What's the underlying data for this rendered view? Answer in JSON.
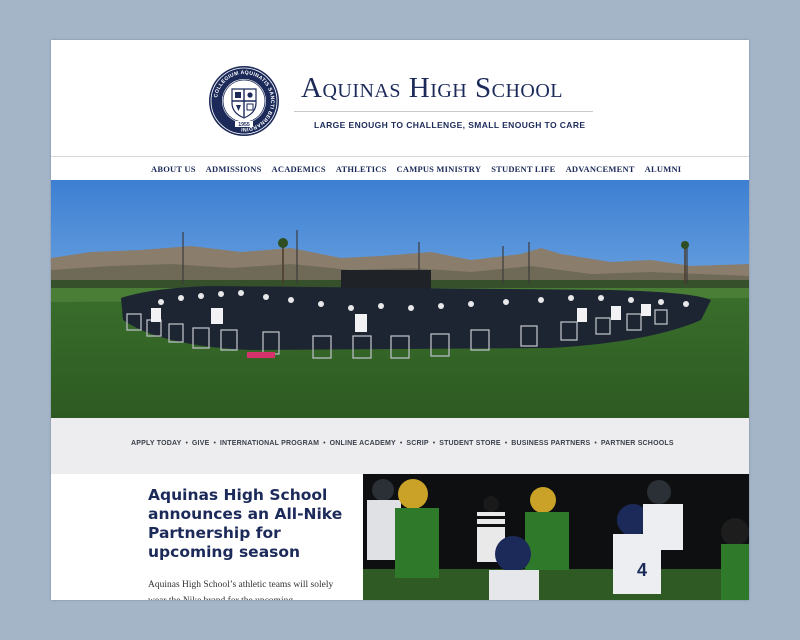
{
  "header": {
    "school_name": "Aquinas High School",
    "tagline": "LARGE ENOUGH TO CHALLENGE, SMALL ENOUGH TO CARE",
    "seal": {
      "ring_text": "COLLEGIUM AQUINATIS SANCTI BERNARDINI",
      "year": "1955"
    }
  },
  "nav": {
    "items": [
      {
        "label": "ABOUT US"
      },
      {
        "label": "ADMISSIONS"
      },
      {
        "label": "ACADEMICS"
      },
      {
        "label": "ATHLETICS"
      },
      {
        "label": "CAMPUS MINISTRY"
      },
      {
        "label": "STUDENT LIFE"
      },
      {
        "label": "ADVANCEMENT"
      },
      {
        "label": "ALUMNI"
      }
    ]
  },
  "quick_links": {
    "items": [
      {
        "label": "APPLY TODAY"
      },
      {
        "label": "GIVE"
      },
      {
        "label": "INTERNATIONAL PROGRAM"
      },
      {
        "label": "ONLINE ACADEMY"
      },
      {
        "label": "SCRIP"
      },
      {
        "label": "STUDENT STORE"
      },
      {
        "label": "BUSINESS PARTNERS"
      },
      {
        "label": "PARTNER SCHOOLS"
      }
    ],
    "separator": "•"
  },
  "news": {
    "headline": "Aquinas High School announces an All-Nike Partnership for upcoming season",
    "excerpt": "Aquinas High School’s athletic teams will solely wear the Nike brand for the upcoming"
  },
  "colors": {
    "brand_navy": "#1c2a5a",
    "page_background": "#a4b5c8",
    "quick_bar": "#ededef"
  }
}
